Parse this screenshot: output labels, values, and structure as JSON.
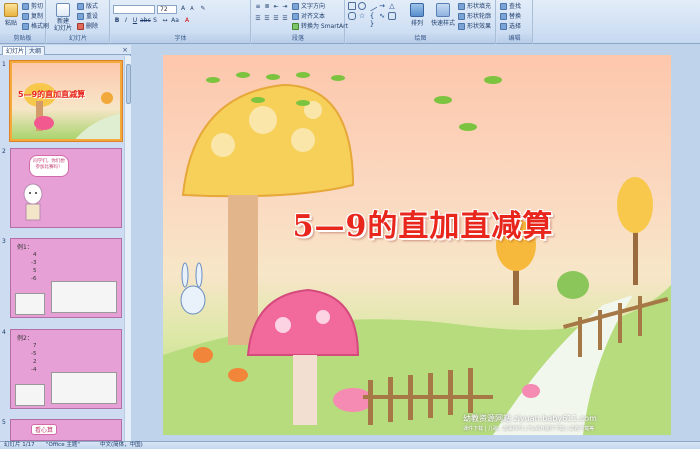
{
  "ribbon": {
    "clipboard": {
      "label": "剪贴板",
      "paste": "粘贴",
      "cut": "剪切",
      "copy": "复制",
      "format_painter": "格式刷"
    },
    "slides": {
      "label": "幻灯片",
      "new_slide": "新建\n幻灯片",
      "layout": "版式",
      "reset": "重设",
      "delete": "删除"
    },
    "font": {
      "label": "字体",
      "font_name": "",
      "font_size": "72"
    },
    "paragraph": {
      "label": "段落",
      "text_direction": "文字方向",
      "align_text": "对齐文本",
      "smartart": "转换为 SmartArt"
    },
    "drawing": {
      "label": "绘图",
      "arrange": "排列",
      "quick_styles": "快速样式",
      "shape_fill": "形状填充",
      "shape_outline": "形状轮廓",
      "shape_effects": "形状效果"
    },
    "editing": {
      "label": "编辑",
      "find": "查找",
      "replace": "替换",
      "select": "选择"
    }
  },
  "leftpanel": {
    "tabs": [
      "幻灯片",
      "大纲"
    ],
    "close": "×",
    "slide_numbers": [
      "1",
      "2",
      "3",
      "4",
      "5"
    ],
    "thumb1_title": "5—9的直加直减算",
    "thumb2_bubble": "同学们，你们想参加比赛吗！",
    "thumb3_title": "例1：",
    "thumb3_values": [
      "4",
      "-3",
      "5",
      "-6"
    ],
    "thumb4_title": "例2：",
    "thumb4_values": [
      "7",
      "-5",
      "2",
      "-4"
    ],
    "thumb5_label": "看心算"
  },
  "slide": {
    "title": "5—9的直加直减算",
    "watermark": "幼教资源网站  ziyuan.baby611.com",
    "watermark_sub": "课件下载 | 儿歌、故事MP3 | FLASH课件下载 | 试卷下载等"
  },
  "statusbar": {
    "slide_info": "幻灯片 1/17",
    "theme": "\"Office 主题\"",
    "language": "中文(简体，中国)"
  },
  "colors": {
    "title_red": "#e8261c",
    "slide_pink": "#e7a0d6",
    "ribbon_blue": "#d2e1f4"
  }
}
